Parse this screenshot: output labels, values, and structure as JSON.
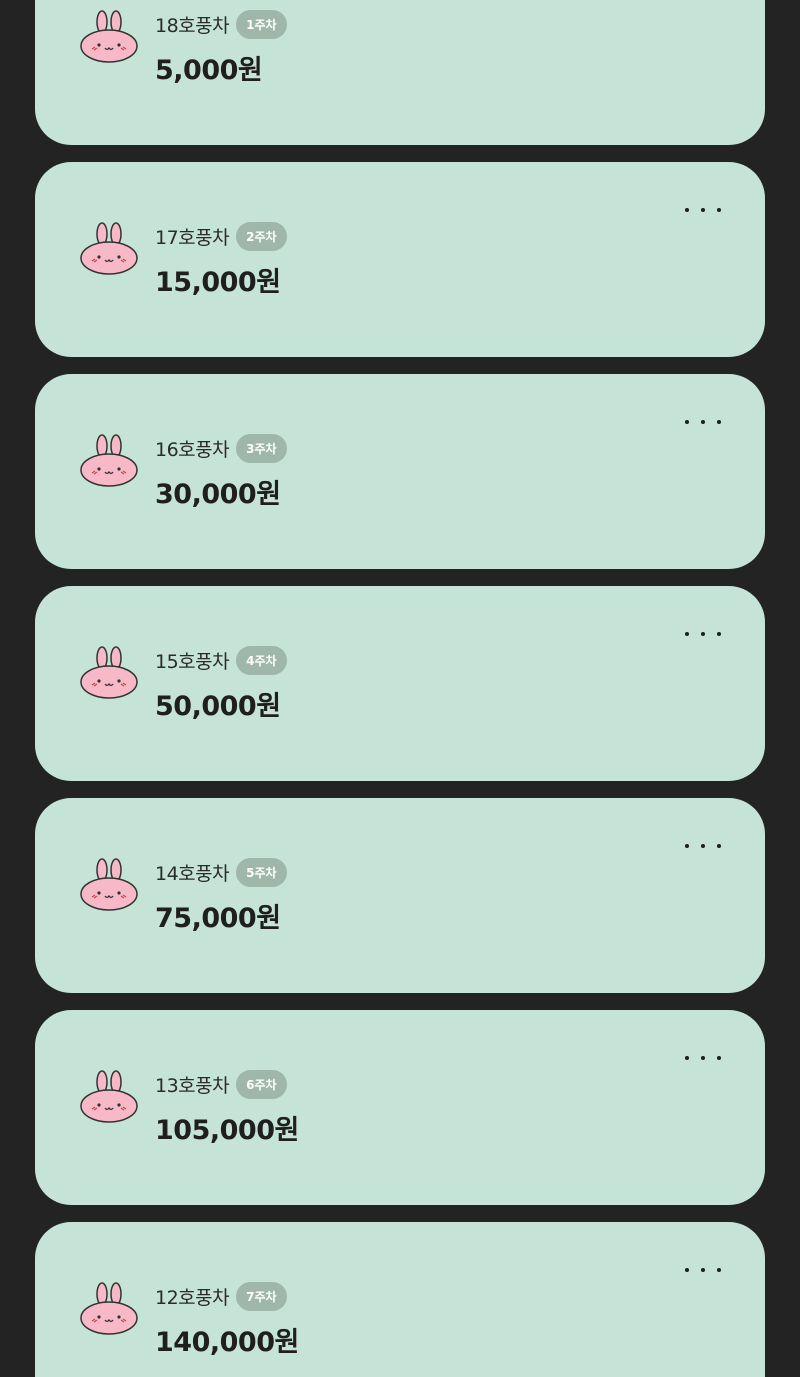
{
  "colors": {
    "background": "#232323",
    "card": "#c6e3d7",
    "badge": "#9fb6ab",
    "avatar": "#f7b9c8"
  },
  "items": [
    {
      "name": "18호풍차",
      "badge": "1주차",
      "amount": "5,000원",
      "icon": "bunny-avatar-icon"
    },
    {
      "name": "17호풍차",
      "badge": "2주차",
      "amount": "15,000원",
      "icon": "bunny-avatar-icon"
    },
    {
      "name": "16호풍차",
      "badge": "3주차",
      "amount": "30,000원",
      "icon": "bunny-avatar-icon"
    },
    {
      "name": "15호풍차",
      "badge": "4주차",
      "amount": "50,000원",
      "icon": "bunny-avatar-icon"
    },
    {
      "name": "14호풍차",
      "badge": "5주차",
      "amount": "75,000원",
      "icon": "bunny-avatar-icon"
    },
    {
      "name": "13호풍차",
      "badge": "6주차",
      "amount": "105,000원",
      "icon": "bunny-avatar-icon"
    },
    {
      "name": "12호풍차",
      "badge": "7주차",
      "amount": "140,000원",
      "icon": "bunny-avatar-icon"
    }
  ]
}
